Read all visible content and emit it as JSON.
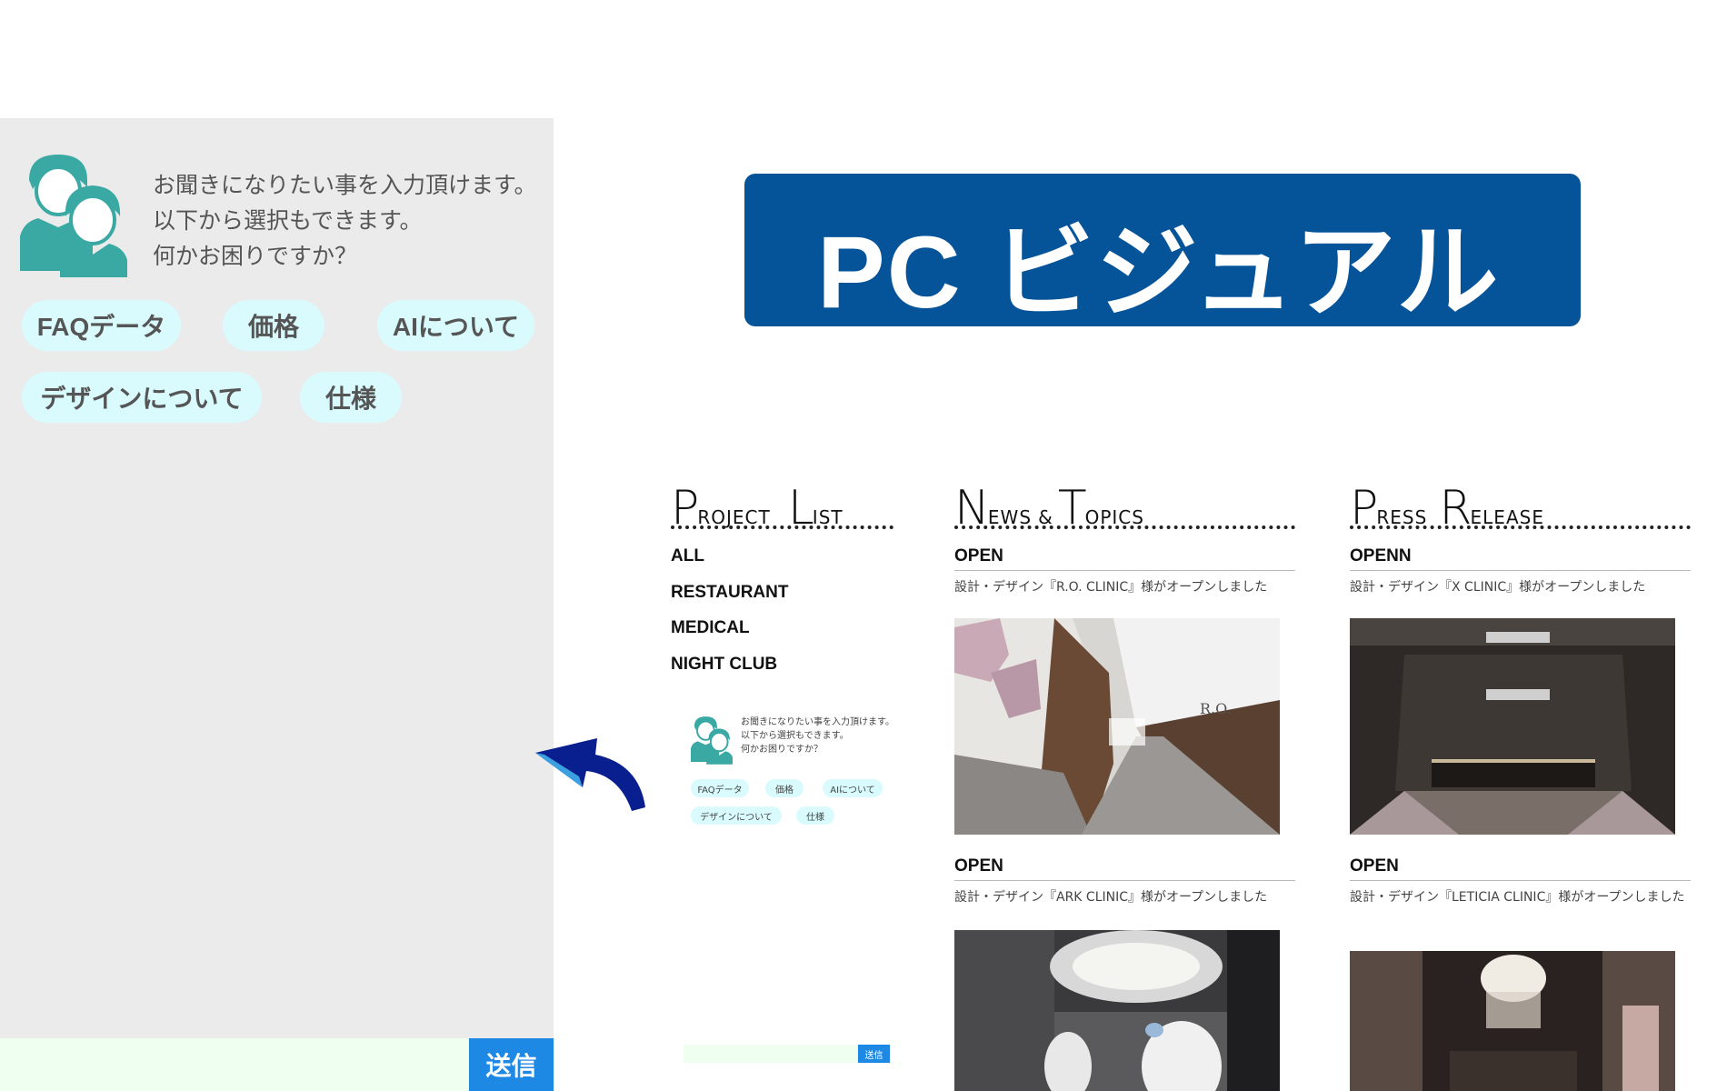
{
  "chat": {
    "intro_lines": [
      "お聞きになりたい事を入力頂けます。",
      "以下から選択もできます。",
      "何かお困りですか？"
    ],
    "chips": [
      "FAQデータ",
      "価格",
      "AIについて",
      "デザインについて",
      "仕様"
    ],
    "input_placeholder": "",
    "send_label": "送信"
  },
  "banner": {
    "title": "PC ビジュアル"
  },
  "colors": {
    "chip_bg": "#d9fbfd",
    "send_button": "#1e88e5",
    "banner_bg": "#05549a",
    "panel_bg": "#ebebeb",
    "avatar": "#3aa9a4"
  },
  "icons": {
    "avatar": "users-avatar-icon",
    "arrow": "curved-back-arrow-icon"
  },
  "site": {
    "project_list": {
      "title_big": [
        "P",
        "L"
      ],
      "title_small": [
        "ROJECT",
        "IST"
      ],
      "items": [
        "ALL",
        "RESTAURANT",
        "MEDICAL",
        "NIGHT CLUB"
      ]
    },
    "news": {
      "title_big": [
        "N",
        "T"
      ],
      "title_small": [
        "EWS",
        "&",
        "OPICS"
      ],
      "entries": [
        {
          "label": "OPEN",
          "desc": "設計・デザイン『R.O. CLINIC』様がオープンしました"
        },
        {
          "label": "OPEN",
          "desc": "設計・デザイン『ARK CLINIC』様がオープンしました"
        }
      ]
    },
    "press": {
      "title_big": [
        "P",
        "R"
      ],
      "title_small": [
        "RESS",
        "ELEASE"
      ],
      "entries": [
        {
          "label": "OPENN",
          "desc": "設計・デザイン『X CLINIC』様がオープンしました"
        },
        {
          "label": "OPEN",
          "desc": "設計・デザイン『LETICIA CLINIC』様がオープンしました"
        }
      ]
    },
    "mini_chat": {
      "intro_lines": [
        "お聞きになりたい事を入力頂けます。",
        "以下から選択もできます。",
        "何かお困りですか？"
      ],
      "chips": [
        "FAQデータ",
        "価格",
        "AIについて",
        "デザインについて",
        "仕様"
      ],
      "send_label": "送信"
    }
  }
}
